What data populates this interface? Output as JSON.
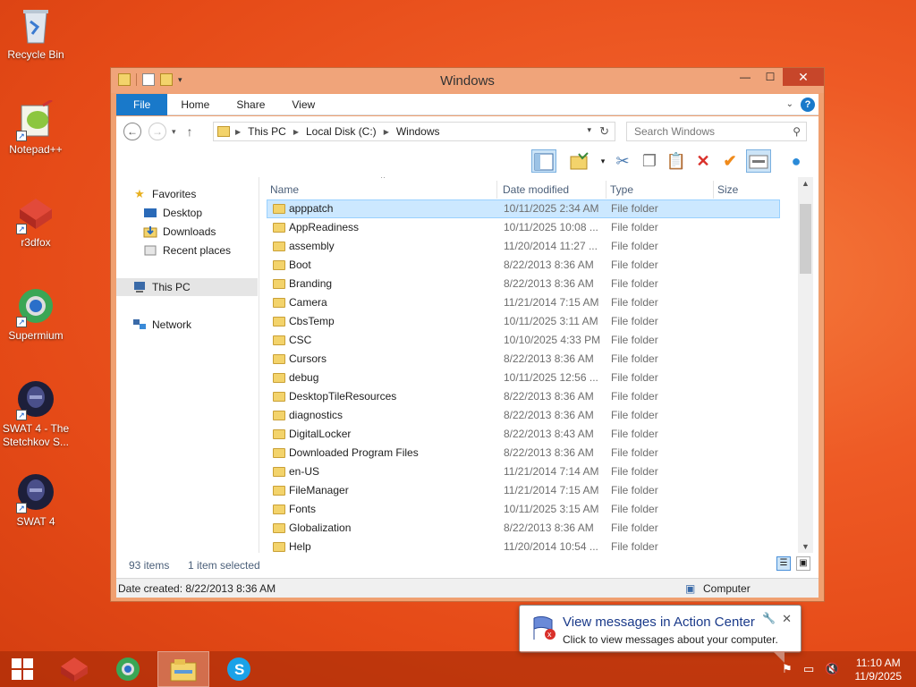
{
  "desktop": {
    "icons": [
      {
        "label": "Recycle Bin",
        "icon": "recycle-bin-icon"
      },
      {
        "label": "Notepad++",
        "icon": "notepad-plus-plus-icon"
      },
      {
        "label": "r3dfox",
        "icon": "r3dfox-icon"
      },
      {
        "label": "Supermium",
        "icon": "supermium-icon"
      },
      {
        "label": "SWAT 4 - The Stetchkov S...",
        "icon": "swat4-stetchkov-icon"
      },
      {
        "label": "SWAT 4",
        "icon": "swat4-icon"
      }
    ]
  },
  "window": {
    "title": "Windows",
    "ribbon_tabs": [
      "File",
      "Home",
      "Share",
      "View"
    ],
    "address": {
      "crumbs": [
        "This PC",
        "Local Disk (C:)",
        "Windows"
      ]
    },
    "search_placeholder": "Search Windows",
    "nav": {
      "favorites": "Favorites",
      "desktop": "Desktop",
      "downloads": "Downloads",
      "recent": "Recent places",
      "this_pc": "This PC",
      "network": "Network"
    },
    "columns": {
      "name": "Name",
      "date": "Date modified",
      "type": "Type",
      "size": "Size"
    },
    "files": [
      {
        "name": "apppatch",
        "date": "10/11/2025 2:34 AM",
        "type": "File folder",
        "selected": true
      },
      {
        "name": "AppReadiness",
        "date": "10/11/2025 10:08 ...",
        "type": "File folder"
      },
      {
        "name": "assembly",
        "date": "11/20/2014 11:27 ...",
        "type": "File folder"
      },
      {
        "name": "Boot",
        "date": "8/22/2013 8:36 AM",
        "type": "File folder"
      },
      {
        "name": "Branding",
        "date": "8/22/2013 8:36 AM",
        "type": "File folder"
      },
      {
        "name": "Camera",
        "date": "11/21/2014 7:15 AM",
        "type": "File folder"
      },
      {
        "name": "CbsTemp",
        "date": "10/11/2025 3:11 AM",
        "type": "File folder"
      },
      {
        "name": "CSC",
        "date": "10/10/2025 4:33 PM",
        "type": "File folder"
      },
      {
        "name": "Cursors",
        "date": "8/22/2013 8:36 AM",
        "type": "File folder"
      },
      {
        "name": "debug",
        "date": "10/11/2025 12:56 ...",
        "type": "File folder"
      },
      {
        "name": "DesktopTileResources",
        "date": "8/22/2013 8:36 AM",
        "type": "File folder"
      },
      {
        "name": "diagnostics",
        "date": "8/22/2013 8:36 AM",
        "type": "File folder"
      },
      {
        "name": "DigitalLocker",
        "date": "8/22/2013 8:43 AM",
        "type": "File folder"
      },
      {
        "name": "Downloaded Program Files",
        "date": "8/22/2013 8:36 AM",
        "type": "File folder"
      },
      {
        "name": "en-US",
        "date": "11/21/2014 7:14 AM",
        "type": "File folder"
      },
      {
        "name": "FileManager",
        "date": "11/21/2014 7:15 AM",
        "type": "File folder"
      },
      {
        "name": "Fonts",
        "date": "10/11/2025 3:15 AM",
        "type": "File folder"
      },
      {
        "name": "Globalization",
        "date": "8/22/2013 8:36 AM",
        "type": "File folder"
      },
      {
        "name": "Help",
        "date": "11/20/2014 10:54 ...",
        "type": "File folder"
      }
    ],
    "status": {
      "item_count": "93 items",
      "selected": "1 item selected",
      "date_created": "Date created: 8/22/2013 8:36 AM",
      "location": "Computer"
    }
  },
  "notification": {
    "title": "View messages in Action Center",
    "body": "Click to view messages about your computer."
  },
  "clock": {
    "time": "11:10 AM",
    "date": "11/9/2025"
  },
  "colors": {
    "accent": "#1979ca",
    "selection": "#cce8ff",
    "window_frame": "#f0a070"
  }
}
